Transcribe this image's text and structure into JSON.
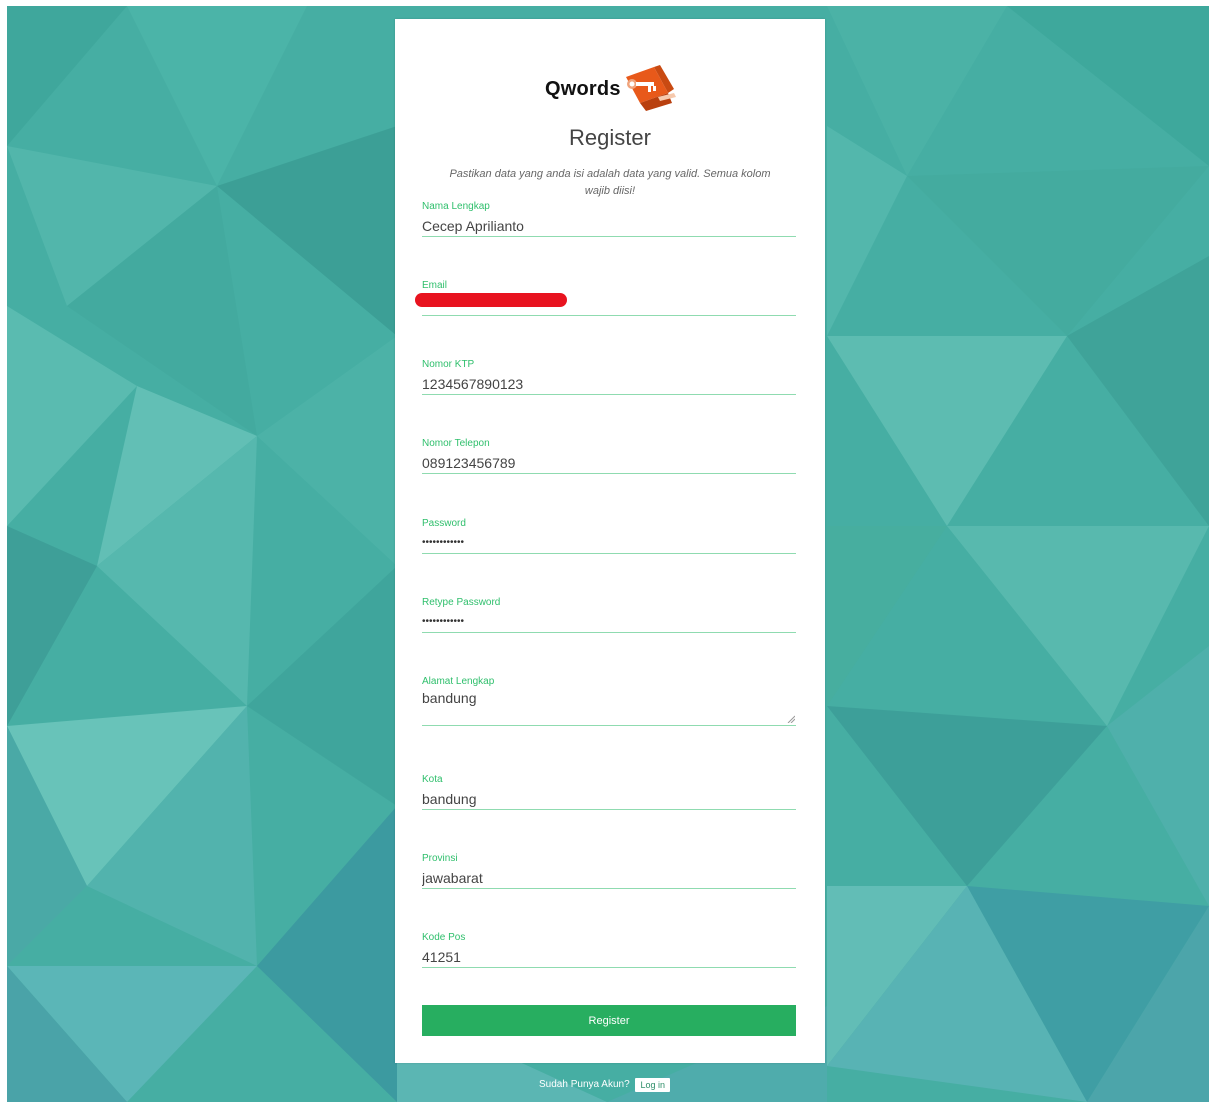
{
  "brand": {
    "name": "Qwords",
    "logo_icon": "qwords-logo-icon"
  },
  "page": {
    "title": "Register",
    "subtitle": "Pastikan data yang anda isi adalah data yang valid. Semua kolom wajib diisi!"
  },
  "form": {
    "fields": [
      {
        "label": "Nama Lengkap",
        "value": "Cecep Aprilianto",
        "type": "text"
      },
      {
        "label": "Email",
        "value": "",
        "type": "email",
        "redacted": true
      },
      {
        "label": "Nomor KTP",
        "value": "1234567890123",
        "type": "text"
      },
      {
        "label": "Nomor Telepon",
        "value": "089123456789",
        "type": "text"
      },
      {
        "label": "Password",
        "value": "••••••••••••",
        "type": "password"
      },
      {
        "label": "Retype Password",
        "value": "••••••••••••",
        "type": "password"
      },
      {
        "label": "Alamat Lengkap",
        "value": "bandung",
        "type": "textarea"
      },
      {
        "label": "Kota",
        "value": "bandung",
        "type": "text"
      },
      {
        "label": "Provinsi",
        "value": "jawabarat",
        "type": "text"
      },
      {
        "label": "Kode Pos",
        "value": "41251",
        "type": "text"
      }
    ],
    "submit_label": "Register"
  },
  "footer": {
    "question": "Sudah Punya Akun?",
    "login_label": "Log in"
  },
  "colors": {
    "accent": "#2fbf6c",
    "button": "#27ae60",
    "background": "#46aea3",
    "redaction": "#e8131f"
  }
}
